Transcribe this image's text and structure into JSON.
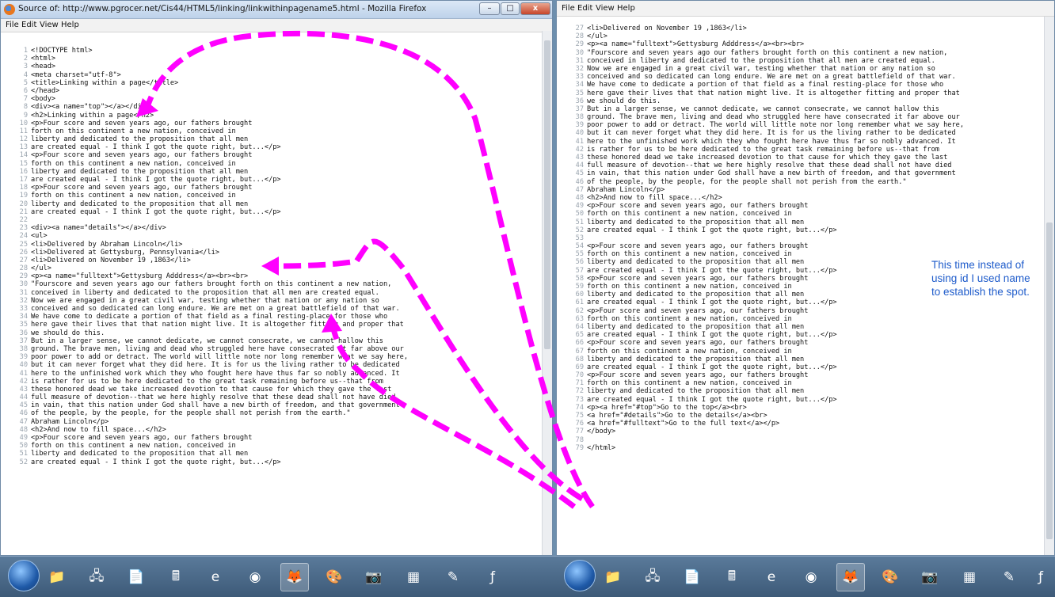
{
  "left_window": {
    "title": "Source of: http://www.pgrocer.net/Cis44/HTML5/linking/linkwithinpagename5.html - Mozilla Firefox",
    "menu": [
      "File",
      "Edit",
      "View",
      "Help"
    ],
    "controls": [
      "–",
      "□",
      "x"
    ],
    "lines": [
      {
        "n": "1",
        "t": "<!DOCTYPE html>"
      },
      {
        "n": "2",
        "t": "<html>"
      },
      {
        "n": "3",
        "t": "<head>"
      },
      {
        "n": "4",
        "t": "<meta charset=\"utf-8\">"
      },
      {
        "n": "5",
        "t": "<title>Linking within a page</title>"
      },
      {
        "n": "6",
        "t": "</head>"
      },
      {
        "n": "7",
        "t": "<body>"
      },
      {
        "n": "8",
        "t": "<div><a name=\"top\"></a></div>"
      },
      {
        "n": "9",
        "t": "<h2>Linking within a page</h2>"
      },
      {
        "n": "10",
        "t": "<p>Four score and seven years ago, our fathers brought"
      },
      {
        "n": "11",
        "t": "forth on this continent a new nation, conceived in"
      },
      {
        "n": "12",
        "t": "liberty and dedicated to the proposition that all men"
      },
      {
        "n": "13",
        "t": "are created equal - I think I got the quote right, but...</p>"
      },
      {
        "n": "14",
        "t": "<p>Four score and seven years ago, our fathers brought"
      },
      {
        "n": "15",
        "t": "forth on this continent a new nation, conceived in"
      },
      {
        "n": "16",
        "t": "liberty and dedicated to the proposition that all men"
      },
      {
        "n": "17",
        "t": "are created equal - I think I got the quote right, but...</p>"
      },
      {
        "n": "18",
        "t": "<p>Four score and seven years ago, our fathers brought"
      },
      {
        "n": "19",
        "t": "forth on this continent a new nation, conceived in"
      },
      {
        "n": "20",
        "t": "liberty and dedicated to the proposition that all men"
      },
      {
        "n": "21",
        "t": "are created equal - I think I got the quote right, but...</p>"
      },
      {
        "n": "22",
        "t": ""
      },
      {
        "n": "23",
        "t": "<div><a name=\"details\"></a></div>"
      },
      {
        "n": "24",
        "t": "<ul>"
      },
      {
        "n": "25",
        "t": "<li>Delivered by Abraham Lincoln</li>"
      },
      {
        "n": "26",
        "t": "<li>Delivered at Gettysburg, Pennsylvania</li>"
      },
      {
        "n": "27",
        "t": "<li>Delivered on November 19 ,1863</li>"
      },
      {
        "n": "28",
        "t": "</ul>"
      },
      {
        "n": "29",
        "t": "<p><a name=\"fulltext\">Gettysburg Adddress</a><br><br>"
      },
      {
        "n": "30",
        "t": "\"Fourscore and seven years ago our fathers brought forth on this continent a new nation,"
      },
      {
        "n": "31",
        "t": "conceived in liberty and dedicated to the proposition that all men are created equal."
      },
      {
        "n": "32",
        "t": "Now we are engaged in a great civil war, testing whether that nation or any nation so"
      },
      {
        "n": "33",
        "t": "conceived and so dedicated can long endure. We are met on a great battlefield of that war."
      },
      {
        "n": "34",
        "t": "We have come to dedicate a portion of that field as a final resting-place for those who"
      },
      {
        "n": "35",
        "t": "here gave their lives that that nation might live. It is altogether fitting and proper that"
      },
      {
        "n": "36",
        "t": "we should do this."
      },
      {
        "n": "37",
        "t": "But in a larger sense, we cannot dedicate, we cannot consecrate, we cannot hallow this"
      },
      {
        "n": "38",
        "t": "ground. The brave men, living and dead who struggled here have consecrated it far above our"
      },
      {
        "n": "39",
        "t": "poor power to add or detract. The world will little note nor long remember what we say here,"
      },
      {
        "n": "40",
        "t": "but it can never forget what they did here. It is for us the living rather to be dedicated"
      },
      {
        "n": "41",
        "t": "here to the unfinished work which they who fought here have thus far so nobly advanced. It"
      },
      {
        "n": "42",
        "t": "is rather for us to be here dedicated to the great task remaining before us--that from"
      },
      {
        "n": "43",
        "t": "these honored dead we take increased devotion to that cause for which they gave the last"
      },
      {
        "n": "44",
        "t": "full measure of devotion--that we here highly resolve that these dead shall not have died"
      },
      {
        "n": "45",
        "t": "in vain, that this nation under God shall have a new birth of freedom, and that government"
      },
      {
        "n": "46",
        "t": "of the people, by the people, for the people shall not perish from the earth.\""
      },
      {
        "n": "47",
        "t": "Abraham Lincoln</p>"
      },
      {
        "n": "48",
        "t": "<h2>And now to fill space...</h2>"
      },
      {
        "n": "49",
        "t": "<p>Four score and seven years ago, our fathers brought"
      },
      {
        "n": "50",
        "t": "forth on this continent a new nation, conceived in"
      },
      {
        "n": "51",
        "t": "liberty and dedicated to the proposition that all men"
      },
      {
        "n": "52",
        "t": "are created equal - I think I got the quote right, but...</p>"
      }
    ]
  },
  "right_window": {
    "menu": [
      "File",
      "Edit",
      "View",
      "Help"
    ],
    "lines": [
      {
        "n": "27",
        "t": "<li>Delivered on November 19 ,1863</li>"
      },
      {
        "n": "28",
        "t": "</ul>"
      },
      {
        "n": "29",
        "t": "<p><a name=\"fulltext\">Gettysburg Adddress</a><br><br>"
      },
      {
        "n": "30",
        "t": "\"Fourscore and seven years ago our fathers brought forth on this continent a new nation,"
      },
      {
        "n": "31",
        "t": "conceived in liberty and dedicated to the proposition that all men are created equal."
      },
      {
        "n": "32",
        "t": "Now we are engaged in a great civil war, testing whether that nation or any nation so"
      },
      {
        "n": "33",
        "t": "conceived and so dedicated can long endure. We are met on a great battlefield of that war."
      },
      {
        "n": "34",
        "t": "We have come to dedicate a portion of that field as a final resting-place for those who"
      },
      {
        "n": "35",
        "t": "here gave their lives that that nation might live. It is altogether fitting and proper that"
      },
      {
        "n": "36",
        "t": "we should do this."
      },
      {
        "n": "37",
        "t": "But in a larger sense, we cannot dedicate, we cannot consecrate, we cannot hallow this"
      },
      {
        "n": "38",
        "t": "ground. The brave men, living and dead who struggled here have consecrated it far above our"
      },
      {
        "n": "39",
        "t": "poor power to add or detract. The world will little note nor long remember what we say here,"
      },
      {
        "n": "40",
        "t": "but it can never forget what they did here. It is for us the living rather to be dedicated"
      },
      {
        "n": "41",
        "t": "here to the unfinished work which they who fought here have thus far so nobly advanced. It"
      },
      {
        "n": "42",
        "t": "is rather for us to be here dedicated to the great task remaining before us--that from"
      },
      {
        "n": "43",
        "t": "these honored dead we take increased devotion to that cause for which they gave the last"
      },
      {
        "n": "44",
        "t": "full measure of devotion--that we here highly resolve that these dead shall not have died"
      },
      {
        "n": "45",
        "t": "in vain, that this nation under God shall have a new birth of freedom, and that government"
      },
      {
        "n": "46",
        "t": "of the people, by the people, for the people shall not perish from the earth.\""
      },
      {
        "n": "47",
        "t": "Abraham Lincoln</p>"
      },
      {
        "n": "48",
        "t": "<h2>And now to fill space...</h2>"
      },
      {
        "n": "49",
        "t": "<p>Four score and seven years ago, our fathers brought"
      },
      {
        "n": "50",
        "t": "forth on this continent a new nation, conceived in"
      },
      {
        "n": "51",
        "t": "liberty and dedicated to the proposition that all men"
      },
      {
        "n": "52",
        "t": "are created equal - I think I got the quote right, but...</p>"
      },
      {
        "n": "53",
        "t": ""
      },
      {
        "n": "54",
        "t": "<p>Four score and seven years ago, our fathers brought"
      },
      {
        "n": "55",
        "t": "forth on this continent a new nation, conceived in"
      },
      {
        "n": "56",
        "t": "liberty and dedicated to the proposition that all men"
      },
      {
        "n": "57",
        "t": "are created equal - I think I got the quote right, but...</p>"
      },
      {
        "n": "58",
        "t": "<p>Four score and seven years ago, our fathers brought"
      },
      {
        "n": "59",
        "t": "forth on this continent a new nation, conceived in"
      },
      {
        "n": "60",
        "t": "liberty and dedicated to the proposition that all men"
      },
      {
        "n": "61",
        "t": "are created equal - I think I got the quote right, but...</p>"
      },
      {
        "n": "62",
        "t": "<p>Four score and seven years ago, our fathers brought"
      },
      {
        "n": "63",
        "t": "forth on this continent a new nation, conceived in"
      },
      {
        "n": "64",
        "t": "liberty and dedicated to the proposition that all men"
      },
      {
        "n": "65",
        "t": "are created equal - I think I got the quote right, but...</p>"
      },
      {
        "n": "66",
        "t": "<p>Four score and seven years ago, our fathers brought"
      },
      {
        "n": "67",
        "t": "forth on this continent a new nation, conceived in"
      },
      {
        "n": "68",
        "t": "liberty and dedicated to the proposition that all men"
      },
      {
        "n": "69",
        "t": "are created equal - I think I got the quote right, but...</p>"
      },
      {
        "n": "70",
        "t": "<p>Four score and seven years ago, our fathers brought"
      },
      {
        "n": "71",
        "t": "forth on this continent a new nation, conceived in"
      },
      {
        "n": "72",
        "t": "liberty and dedicated to the proposition that all men"
      },
      {
        "n": "73",
        "t": "are created equal - I think I got the quote right, but...</p>"
      },
      {
        "n": "74",
        "t": "<p><a href=\"#top\">Go to the top</a><br>"
      },
      {
        "n": "75",
        "t": "<a href=\"#details\">Go to the details</a><br>"
      },
      {
        "n": "76",
        "t": "<a href=\"#fulltext\">Go to the full text</a></p>"
      },
      {
        "n": "77",
        "t": "</body>"
      },
      {
        "n": "78",
        "t": ""
      },
      {
        "n": "79",
        "t": "</html>"
      }
    ]
  },
  "annotation": {
    "text": "This time instead of using id I used name to establish the spot.",
    "color": "#1f5ccb",
    "arrow_color": "#ff00ff"
  },
  "taskbar": {
    "icons": [
      "start-orb",
      "explorer-icon",
      "network-icon",
      "notepad-icon",
      "calculator-icon",
      "ie-icon",
      "chrome-icon",
      "firefox-icon",
      "paint-icon",
      "camera-icon",
      "spreadsheet-icon",
      "editor-icon",
      "flash-icon"
    ]
  }
}
